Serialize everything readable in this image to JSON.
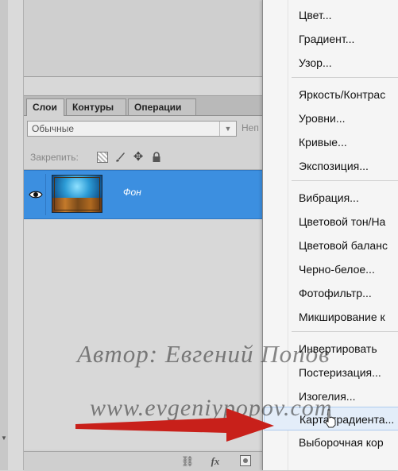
{
  "colors": {
    "selection": "#3c8fe0",
    "menu_hover": "#e3edf9",
    "arrow": "#c8201a"
  },
  "layers_panel": {
    "tabs": [
      {
        "label": "Слои",
        "active": true
      },
      {
        "label": "Контуры",
        "active": false
      },
      {
        "label": "Операции",
        "active": false
      }
    ],
    "blend_mode": "Обычные",
    "opacity_label_partial": "Неп",
    "lock_label": "Закрепить:",
    "layers": [
      {
        "name": "Фон",
        "visible": true,
        "selected": true
      }
    ],
    "bottom_icons": [
      "link-icon",
      "fx-icon",
      "mask-icon"
    ],
    "bottom_fx_label": "fx"
  },
  "menu": {
    "groups": [
      [
        "Цвет...",
        "Градиент...",
        "Узор..."
      ],
      [
        "Яркость/Контрас",
        "Уровни...",
        "Кривые...",
        "Экспозиция..."
      ],
      [
        "Вибрация...",
        "Цветовой тон/На",
        "Цветовой баланс",
        "Черно-белое...",
        "Фотофильтр...",
        "Микширование к"
      ],
      [
        "Инвертировать",
        "Постеризация...",
        "Изогелия...",
        "Карта градиента...",
        "Выборочная кор"
      ]
    ],
    "highlighted": "Карта градиента..."
  },
  "watermark": {
    "line1": "Автор: Евгений Попов",
    "line2": "www.evgeniypopov.com"
  }
}
